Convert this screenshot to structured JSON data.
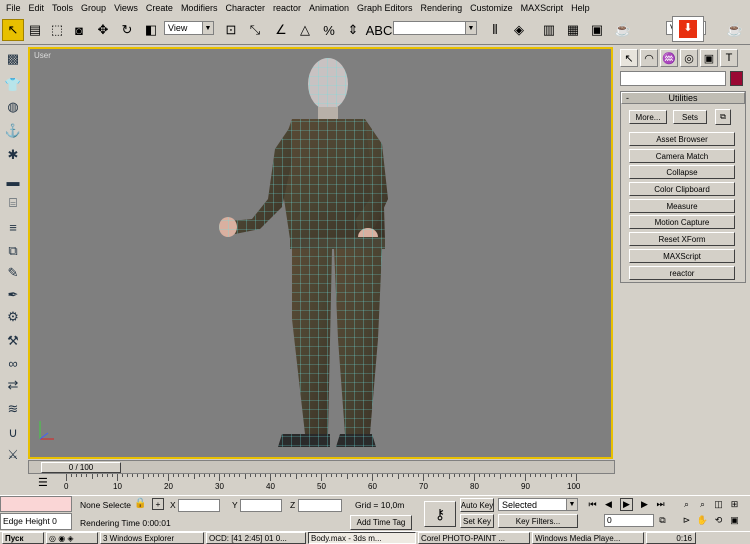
{
  "menu": [
    "File",
    "Edit",
    "Tools",
    "Group",
    "Views",
    "Create",
    "Modifiers",
    "Character",
    "reactor",
    "Animation",
    "Graph Editors",
    "Rendering",
    "Customize",
    "MAXScript",
    "Help"
  ],
  "toolbar": {
    "view_combo": "View",
    "view_combo_right": "Vi",
    "selection_set": ""
  },
  "viewport": {
    "label": "User",
    "bg_color": "#7f7f7f",
    "active_border": "#e8c000"
  },
  "command_panel": {
    "rollout_title": "Utilities",
    "more_button": "More...",
    "sets_button": "Sets",
    "utilities": [
      "Asset Browser",
      "Camera Match",
      "Collapse",
      "Color Clipboard",
      "Measure",
      "Motion Capture",
      "Reset XForm",
      "MAXScript",
      "reactor"
    ],
    "object_color": "#9a0833"
  },
  "time_slider": {
    "position_label": "0 / 100"
  },
  "ruler": {
    "labels": [
      "0",
      "10",
      "20",
      "30",
      "40",
      "50",
      "60",
      "70",
      "80",
      "90",
      "100"
    ]
  },
  "status": {
    "maxscript_listener": "Edge Height 0",
    "selection_info": "None Selecte",
    "prompt": "Rendering Time  0:00:01",
    "x_label": "X",
    "y_label": "Y",
    "z_label": "Z",
    "grid": "Grid = 10,0m",
    "add_time_tag": "Add Time Tag",
    "auto_key": "Auto Key",
    "set_key": "Set Key",
    "selected_combo": "Selected",
    "key_filters": "Key Filters...",
    "frame": "0"
  },
  "taskbar": {
    "start": "Пуск",
    "items": [
      "3 Windows Explorer",
      "OCD: [41 2:45] 01 0...",
      "Body.max - 3ds m...",
      "Corel PHOTO-PAINT ...",
      "Windows Media Playe..."
    ],
    "clock": "0:16"
  }
}
